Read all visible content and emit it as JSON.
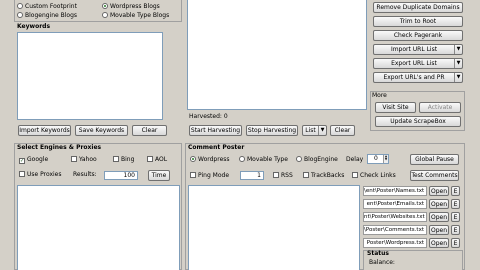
{
  "footprint": {
    "custom_footprint": "Custom Footprint",
    "blogengine_blogs": "Blogengine Blogs",
    "wordpress_blogs": "Wordpress Blogs",
    "movable_type_blogs": "Movable Type Blogs"
  },
  "keywords": {
    "label": "Keywords",
    "import_button": "Import Keywords",
    "save_button": "Save Keywords",
    "clear_button": "Clear"
  },
  "harvester": {
    "harvested_label": "Harvested:",
    "harvested_count": "0",
    "start_button": "Start Harvesting",
    "stop_button": "Stop Harvesting",
    "list_button": "List",
    "clear_button": "Clear"
  },
  "url_tools": {
    "remove_duplicate": "Remove Duplicate Domains",
    "trim_to_root": "Trim to Root",
    "check_pagerank": "Check Pagerank",
    "import_url_list": "Import URL List",
    "export_url_list": "Export URL List",
    "export_urls_pr": "Export URL's and PR"
  },
  "more": {
    "label": "More",
    "visit_site": "Visit Site",
    "activate": "Activate",
    "update": "Update ScrapeBox"
  },
  "engines": {
    "title": "Select Engines & Proxies",
    "google": "Google",
    "yahoo": "Yahoo",
    "bing": "Bing",
    "aol": "AOL",
    "use_proxies": "Use Proxies",
    "results_label": "Results:",
    "results_value": "100",
    "time_button": "Time"
  },
  "poster": {
    "title": "Comment Poster",
    "wordpress": "Wordpress",
    "movable_type": "Movable Type",
    "blogengine": "BlogEngine",
    "delay_label": "Delay",
    "delay_value": "0",
    "global_pause": "Global Pause",
    "ping_mode": "Ping Mode",
    "ping_value": "1",
    "rss": "RSS",
    "trackbacks": "TrackBacks",
    "check_links": "Check Links",
    "test_comments": "Test Comments"
  },
  "files": [
    {
      "name": "\\ent\\Poster\\Names.txt",
      "open": "Open",
      "e": "E"
    },
    {
      "name": "ent\\Poster\\Emails.txt",
      "open": "Open",
      "e": "E"
    },
    {
      "name": "nt\\Poster\\Websites.txt",
      "open": "Open",
      "e": "E"
    },
    {
      "name": "\\Poster\\Comments.txt",
      "open": "Open",
      "e": "E"
    },
    {
      "name": "Poster\\Wordpress.txt",
      "open": "Open",
      "e": "E"
    }
  ],
  "status": {
    "label": "Status",
    "balance_label": "Balance:"
  },
  "colors": {
    "window_bg": "#d4d0c8",
    "field_border": "#7f9db9",
    "check_green": "#1a5a1a"
  }
}
